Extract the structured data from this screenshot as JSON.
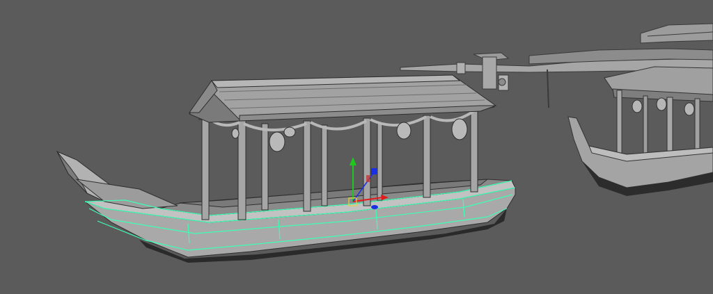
{
  "viewport": {
    "background": "#5b5b5b",
    "model_fill": "#9a9a9a",
    "model_edge": "#2e2e2e",
    "selection_color": "#3dffb4"
  },
  "gizmo": {
    "x_axis_color": "#e11a1a",
    "y_axis_color": "#1ec81e",
    "z_axis_color": "#1a2ee6",
    "pivot_color": "#e8d23a",
    "icons": [
      "move-x-arrow-icon",
      "move-y-arrow-icon",
      "move-z-arrow-icon",
      "pivot-square-icon"
    ]
  },
  "objects": [
    {
      "id": "boat-main",
      "selected": true
    },
    {
      "id": "boat-right",
      "selected": false
    },
    {
      "id": "pavilion-far",
      "selected": false
    }
  ]
}
